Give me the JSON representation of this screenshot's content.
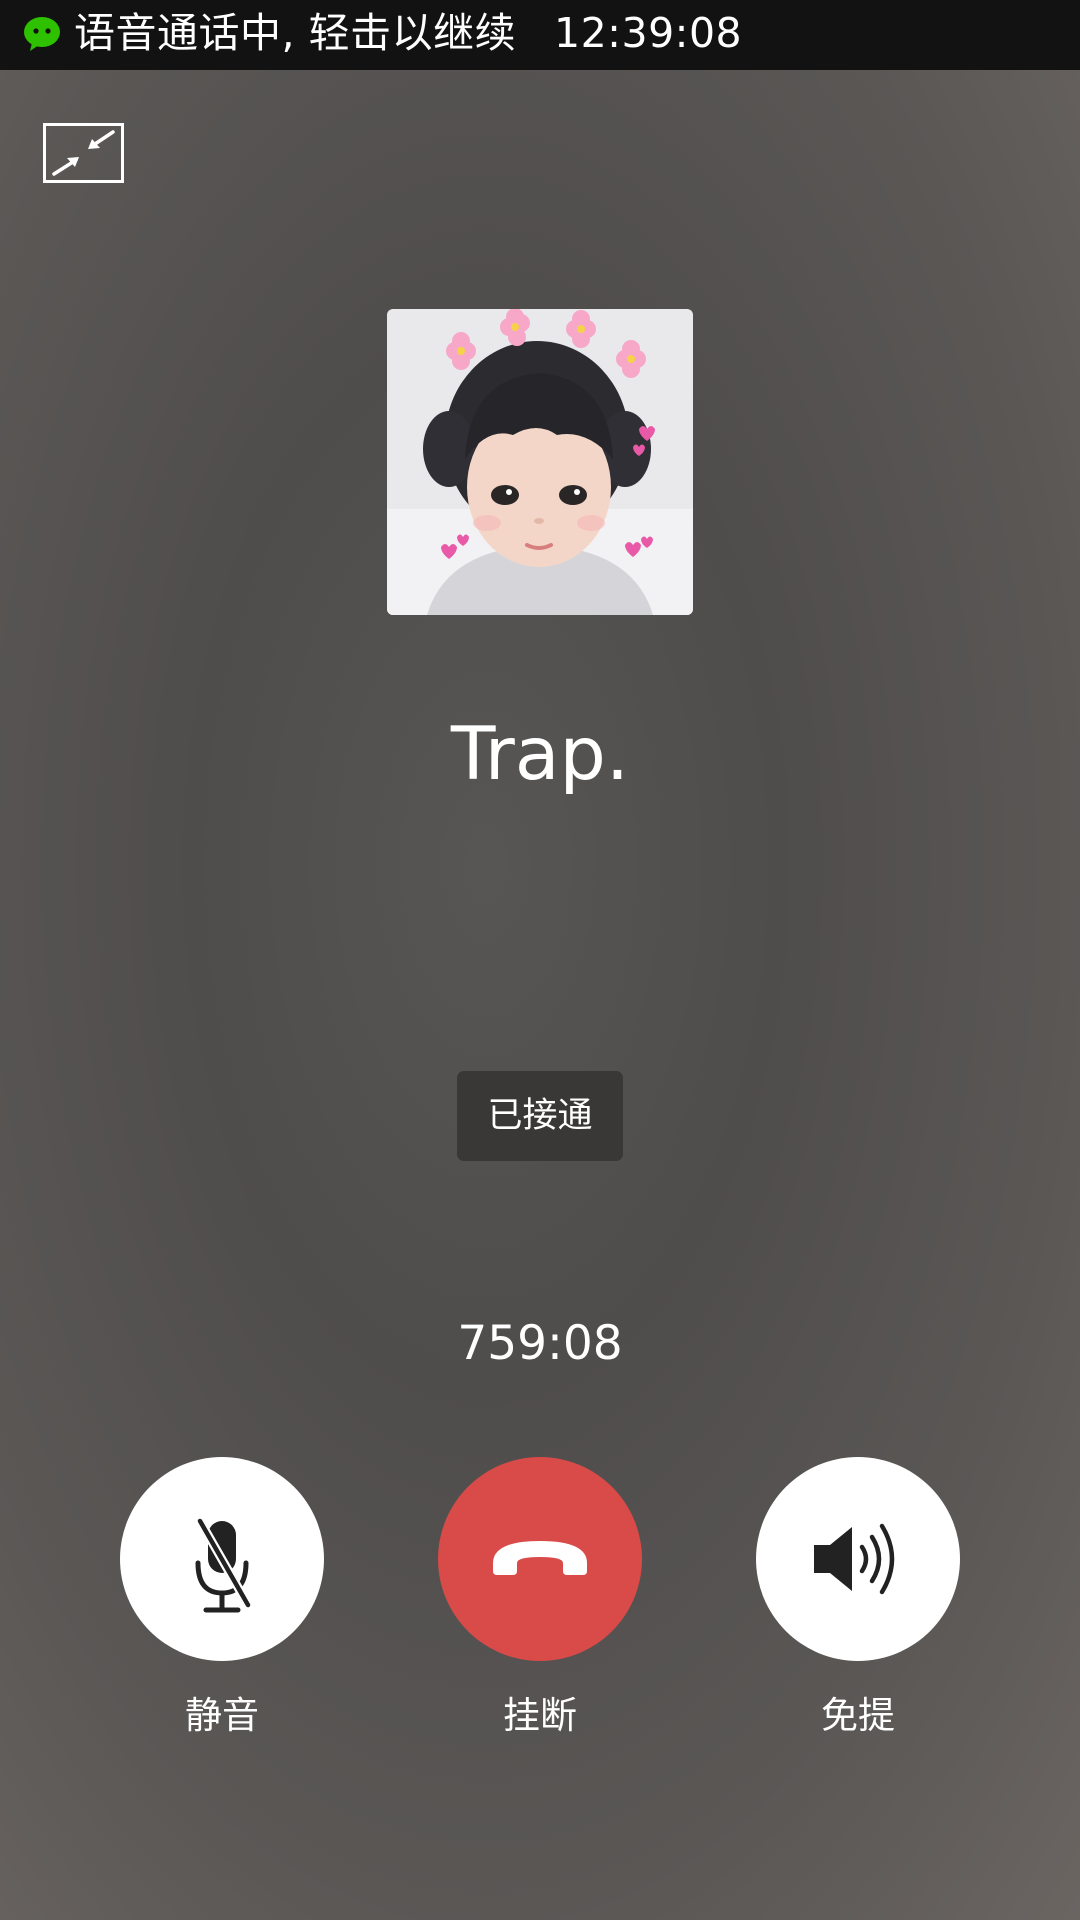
{
  "status_bar": {
    "notification_text": "语音通话中, 轻击以继续",
    "time": "12:39:08",
    "app_icon": "wechat-icon"
  },
  "call": {
    "minimize_icon": "minimize-icon",
    "avatar_icon": "avatar",
    "caller_name": "Trap.",
    "status": "已接通",
    "duration": "759:08"
  },
  "controls": {
    "mute": {
      "label": "静音",
      "icon": "mic-off-icon"
    },
    "hangup": {
      "label": "挂断",
      "icon": "phone-hangup-icon"
    },
    "speaker": {
      "label": "免提",
      "icon": "speaker-icon"
    }
  },
  "colors": {
    "hangup": "#d94b48",
    "wechat_green": "#2dc100",
    "status_bar": "#121213"
  }
}
